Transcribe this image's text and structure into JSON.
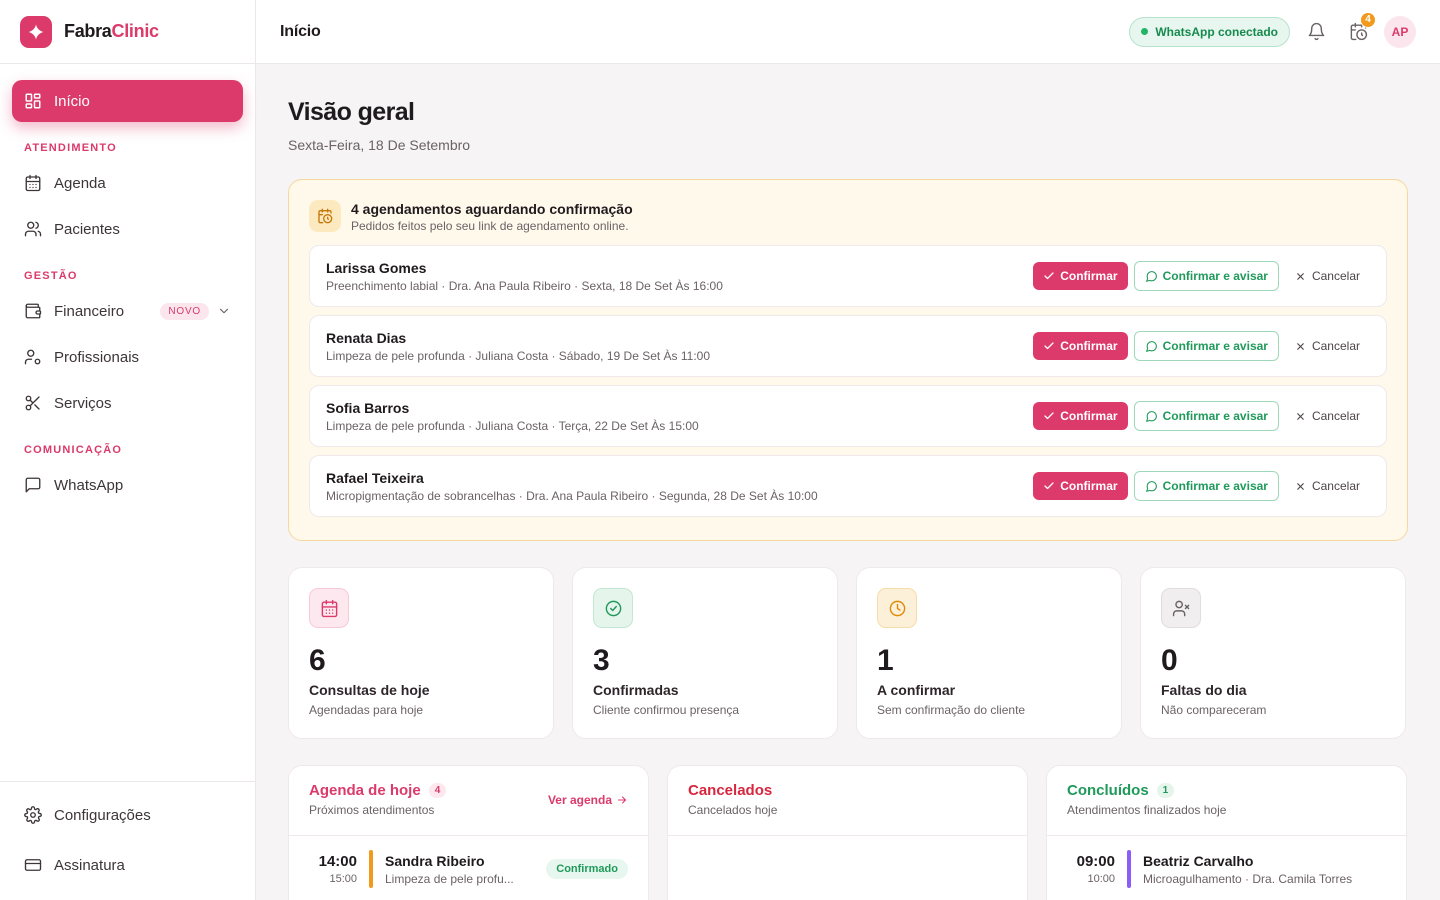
{
  "brand": {
    "part1": "Fabra",
    "part2": "Clinic"
  },
  "sidebar": {
    "home": "Início",
    "sections": {
      "atendimento": "ATENDIMENTO",
      "gestao": "GESTÃO",
      "comunicacao": "COMUNICAÇÃO"
    },
    "items": {
      "agenda": "Agenda",
      "pacientes": "Pacientes",
      "financeiro": "Financeiro",
      "financeiro_badge": "NOVO",
      "profissionais": "Profissionais",
      "servicos": "Serviços",
      "whatsapp": "WhatsApp"
    },
    "bottom": {
      "configuracoes": "Configurações",
      "assinatura": "Assinatura"
    }
  },
  "topbar": {
    "title": "Início",
    "whatsapp_status": "WhatsApp conectado",
    "pending_count": "4",
    "avatar_initials": "AP"
  },
  "main": {
    "title": "Visão geral",
    "date": "Sexta-Feira, 18 De Setembro"
  },
  "pending": {
    "title": "4 agendamentos aguardando confirmação",
    "subtitle": "Pedidos feitos pelo seu link de agendamento online.",
    "confirm_label": "Confirmar",
    "notify_label": "Confirmar e avisar",
    "cancel_label": "Cancelar",
    "requests": [
      {
        "name": "Larissa Gomes",
        "detail": "Preenchimento labial · Dra. Ana Paula Ribeiro · Sexta, 18 De Set Às 16:00"
      },
      {
        "name": "Renata Dias",
        "detail": "Limpeza de pele profunda · Juliana Costa · Sábado, 19 De Set Às 11:00"
      },
      {
        "name": "Sofia Barros",
        "detail": "Limpeza de pele profunda · Juliana Costa · Terça, 22 De Set Às 15:00"
      },
      {
        "name": "Rafael Teixeira",
        "detail": "Micropigmentação de sobrancelhas · Dra. Ana Paula Ribeiro · Segunda, 28 De Set Às 10:00"
      }
    ]
  },
  "stats": [
    {
      "value": "6",
      "label": "Consultas de hoje",
      "sub": "Agendadas para hoje",
      "icon": "calendar-icon",
      "color": "#db3a6b",
      "bg": "#fde8ef"
    },
    {
      "value": "3",
      "label": "Confirmadas",
      "sub": "Cliente confirmou presença",
      "icon": "check-circle-icon",
      "color": "#1f9a5a",
      "bg": "#e5f5ec"
    },
    {
      "value": "1",
      "label": "A confirmar",
      "sub": "Sem confirmação do cliente",
      "icon": "clock-icon",
      "color": "#e08a0c",
      "bg": "#fdf0d8"
    },
    {
      "value": "0",
      "label": "Faltas do dia",
      "sub": "Não compareceram",
      "icon": "user-x-icon",
      "color": "#6b6266",
      "bg": "#f1eef0"
    }
  ],
  "agenda_card": {
    "title": "Agenda de hoje",
    "count": "4",
    "subtitle": "Próximos atendimentos",
    "link": "Ver agenda",
    "first": {
      "time": "14:00",
      "end": "15:00",
      "name": "Sandra Ribeiro",
      "detail": "Limpeza de pele profu...",
      "status": "Confirmado"
    }
  },
  "cancelled_card": {
    "title": "Cancelados",
    "subtitle": "Cancelados hoje"
  },
  "done_card": {
    "title": "Concluídos",
    "count": "1",
    "subtitle": "Atendimentos finalizados hoje",
    "first": {
      "time": "09:00",
      "end": "10:00",
      "name": "Beatriz Carvalho",
      "detail": "Microagulhamento · Dra. Camila Torres"
    }
  },
  "colors": {
    "brand": "#db3a6b",
    "success": "#1f9a5a",
    "warning": "#f29a1d",
    "danger": "#d9263f",
    "violet": "#8b5cf6"
  }
}
